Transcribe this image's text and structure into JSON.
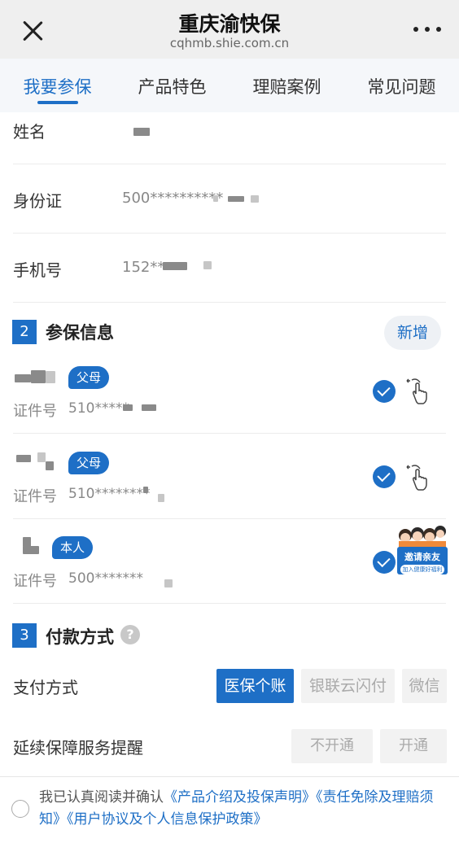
{
  "header": {
    "title": "重庆渝快保",
    "subtitle": "cqhmb.shie.com.cn"
  },
  "tabs": [
    {
      "label": "我要参保",
      "active": true
    },
    {
      "label": "产品特色",
      "active": false
    },
    {
      "label": "理赔案例",
      "active": false
    },
    {
      "label": "常见问题",
      "active": false
    }
  ],
  "applicant": {
    "name_label": "姓名",
    "id_label": "身份证",
    "id_value": "500**********",
    "phone_label": "手机号",
    "phone_value": "152**"
  },
  "insured_section": {
    "number": "2",
    "title": "参保信息",
    "add_label": "新增",
    "persons": [
      {
        "relation": "父母",
        "cert_label": "证件号",
        "cert_value": "510*****",
        "selected": true
      },
      {
        "relation": "父母",
        "cert_label": "证件号",
        "cert_value": "510********",
        "selected": true
      },
      {
        "relation": "本人",
        "cert_label": "证件号",
        "cert_value": "500*******",
        "selected": true
      }
    ],
    "invite": {
      "label": "邀请亲友",
      "sub": "加入健康好福利"
    }
  },
  "payment_section": {
    "number": "3",
    "title": "付款方式",
    "help_icon": "?",
    "method_label": "支付方式",
    "methods": [
      {
        "label": "医保个账",
        "active": true
      },
      {
        "label": "银联云闪付",
        "active": false
      },
      {
        "label": "微信",
        "active": false
      }
    ],
    "reminder_label": "延续保障服务提醒",
    "reminder_options": [
      {
        "label": "不开通"
      },
      {
        "label": "开通"
      }
    ]
  },
  "footer": {
    "prefix": "我已认真阅读并确认",
    "link1": "《产品介绍及投保声明》",
    "link2": "《责任免除及理赔须知》",
    "link3": "《用户协议及个人信息保护政策》"
  },
  "colors": {
    "accent": "#1e6fc6",
    "header_bg": "#efefef",
    "tab_bg": "#f5f7fa"
  }
}
